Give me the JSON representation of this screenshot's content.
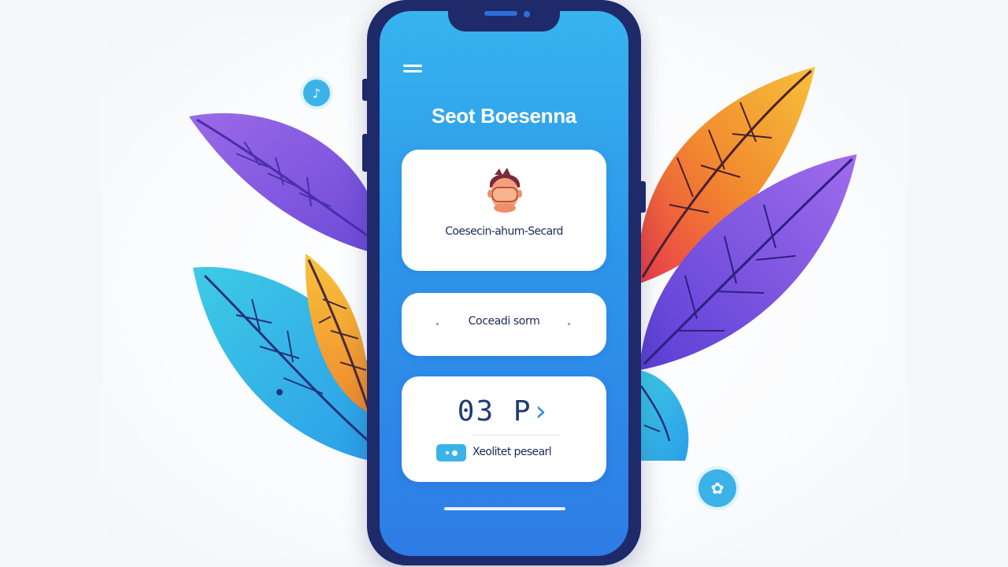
{
  "app": {
    "title": "Seot Boesenna",
    "profile_caption": "Coesecin-ahum-Secard",
    "primary_button_label": "Coceadi sorm",
    "code_digits": "03 P",
    "code_arrow": "›",
    "code_caption": "Xeolitet pesearl"
  },
  "icons": {
    "menu": "menu-icon",
    "avatar": "user-avatar-icon",
    "chip": "toggle-chip-icon",
    "dot_top": "info-dot-icon",
    "dot_bottom": "help-dot-icon"
  },
  "floating_dots": {
    "top_glyph": "♪",
    "bottom_glyph": "✿"
  },
  "colors": {
    "phone_frame": "#1f2a6b",
    "screen_top": "#36b4ef",
    "screen_bottom": "#2e7ce6",
    "card_bg": "#ffffff",
    "text_dark": "#1e2a5c",
    "accent_cyan": "#3bb3e8",
    "leaf_purple": "#8a5be6",
    "leaf_orange": "#f2a63a",
    "leaf_blue": "#36b9e8"
  }
}
